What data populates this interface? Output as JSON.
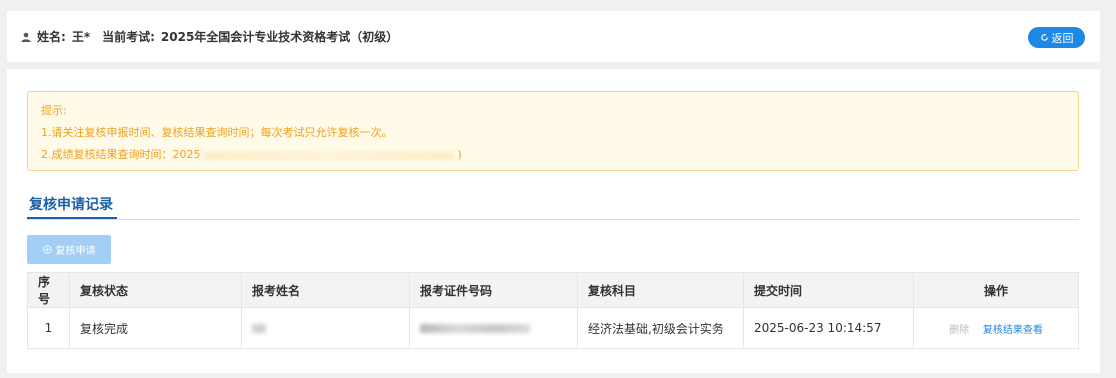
{
  "header": {
    "user_label": "姓名:",
    "user_name": "王*",
    "exam_label": "当前考试:",
    "exam_name": "2025年全国会计专业技术资格考试（初级）",
    "back_label": "返回"
  },
  "tips": {
    "title": "提示:",
    "line1": "1.请关注复核申报时间、复核结果查询时间；每次考试只允许复核一次。",
    "line2_prefix": "2.成绩复核结果查询时间：2025",
    "line2_suffix": ")"
  },
  "section": {
    "title": "复核申请记录"
  },
  "apply_button": {
    "label": "复核申请"
  },
  "table": {
    "headers": [
      "序号",
      "复核状态",
      "报考姓名",
      "报考证件号码",
      "复核科目",
      "提交时间",
      "操作"
    ],
    "rows": [
      {
        "index": "1",
        "status": "复核完成",
        "subjects": "经济法基础,初级会计实务",
        "submit_time": "2025-06-23 10:14:57",
        "delete_label": "删除",
        "view_label": "复核结果查看"
      }
    ]
  },
  "colors": {
    "primary": "#1e88e5",
    "tip_text": "#f0a020",
    "tip_bg": "#fffbe8",
    "disabled_btn": "#a3cff7"
  },
  "icons": {
    "user": "user-icon",
    "back": "refresh-icon",
    "apply": "plus-circle-icon"
  }
}
